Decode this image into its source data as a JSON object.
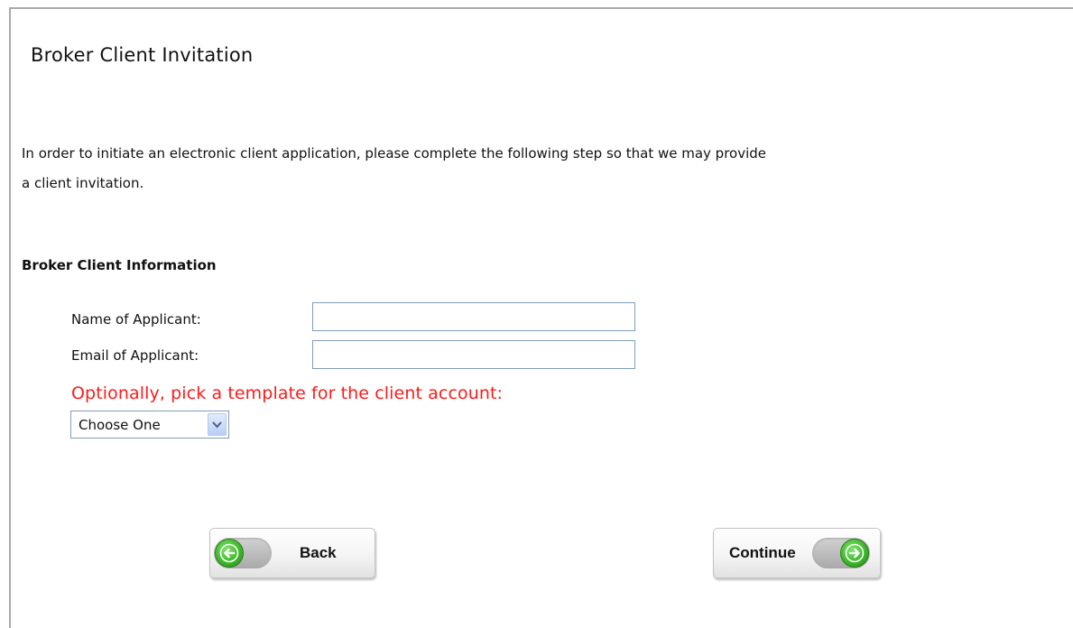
{
  "page": {
    "title": "Broker Client Invitation",
    "intro_line1": "In order to initiate an electronic client application, please complete the following step so that we may provide",
    "intro_line2": "a client invitation."
  },
  "section": {
    "title": "Broker Client Information"
  },
  "form": {
    "name_label": "Name of Applicant:",
    "name_value": "",
    "email_label": "Email of Applicant:",
    "email_value": "",
    "template_note": "Optionally, pick a template for the client account:",
    "template_selected": "Choose One"
  },
  "buttons": {
    "back_label": "Back",
    "back_icon": "arrow-left-icon",
    "continue_label": "Continue",
    "continue_icon": "arrow-right-icon"
  },
  "colors": {
    "note_red": "#ff1a1a",
    "button_green": "#3fb72c",
    "input_border": "#7f9db9"
  }
}
